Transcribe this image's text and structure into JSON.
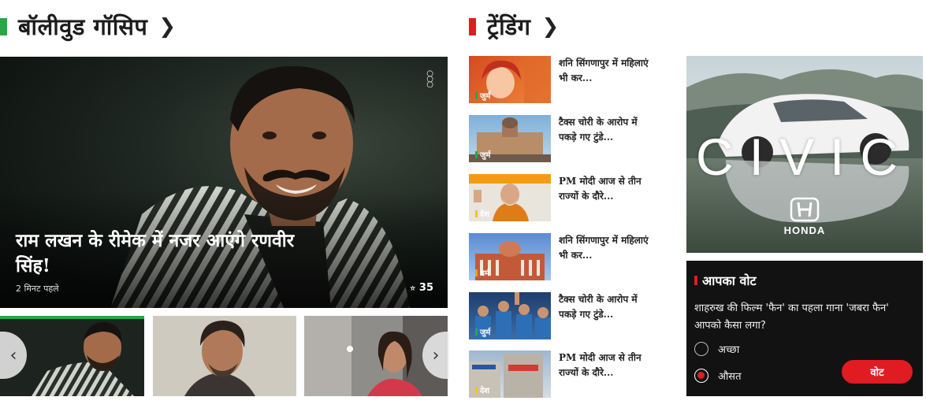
{
  "colors": {
    "green": "#27a844",
    "red": "#e11b22",
    "yellow": "#f5c518",
    "orange": "#f39c12"
  },
  "bollywood": {
    "heading": "बॉलीवुड गॉसिप",
    "hero": {
      "title": "राम लखन के रीमेक में नजर आएंगे रणवीर सिंह!",
      "time": "2 मिनट पहले",
      "shares": "35"
    }
  },
  "trending": {
    "heading": "ट्रेंडिंग",
    "items": [
      {
        "title": "शनि सिंगणापुर में महिलाएं भी कर...",
        "tag": "जुर्म"
      },
      {
        "title": "टैक्स चोरी के आरोप में पकड़े गए टुंडे...",
        "tag": "जुर्म"
      },
      {
        "title": "PM मोदी आज से तीन राज्यों के दौरे...",
        "tag": "देश"
      },
      {
        "title": "शनि सिंगणापुर में महिलाएं भी कर...",
        "tag": "धर्म"
      },
      {
        "title": "टैक्स चोरी के आरोप में पकड़े गए टुंडे...",
        "tag": "जुर्म"
      },
      {
        "title": "PM मोदी आज से तीन राज्यों के दौरे...",
        "tag": "देश"
      }
    ]
  },
  "ad": {
    "model": "CIVIC",
    "brand": "HONDA"
  },
  "poll": {
    "heading": "आपका वोट",
    "question": "शाहरुख की फिल्म 'फैन' का पहला गाना 'जबरा फैन' आपको कैसा लगा?",
    "options": [
      "अच्छा",
      "औसत"
    ],
    "vote_label": "वोट"
  }
}
